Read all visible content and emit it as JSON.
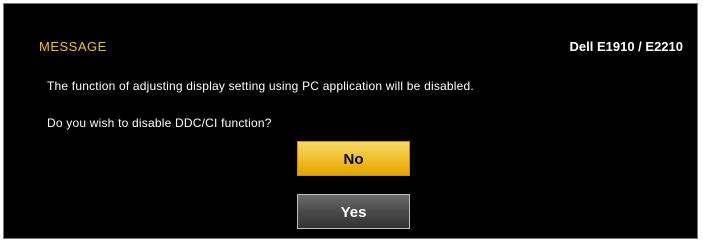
{
  "dialog": {
    "title": "MESSAGE",
    "model": "Dell E1910 / E2210",
    "message_line1": "The function of adjusting display setting using PC application will be disabled.",
    "message_line2": "Do you wish to disable DDC/CI function?"
  },
  "buttons": {
    "no_label": "No",
    "yes_label": "Yes",
    "selected": "No"
  },
  "colors": {
    "background": "#000000",
    "title": "#e8c22b",
    "text": "#ffffff",
    "selected_button": "#f1c232",
    "unselected_button": "#4a4a4a"
  }
}
